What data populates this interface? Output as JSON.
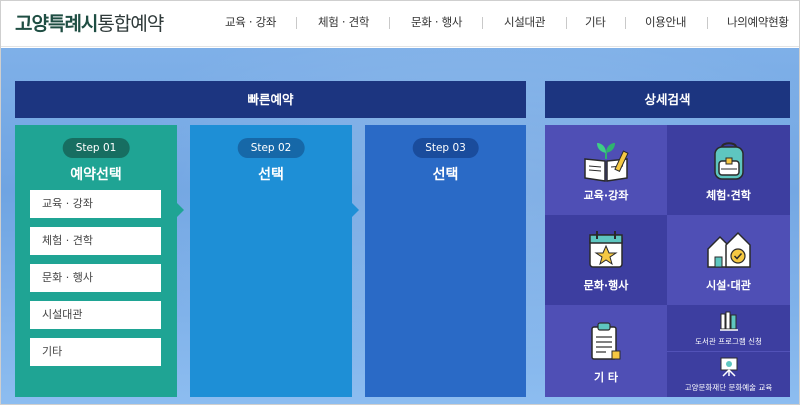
{
  "logo": {
    "bold": "고양특례시",
    "regular": "통합예약"
  },
  "nav": [
    {
      "label": "교육 · 강좌"
    },
    {
      "label": "체험 · 견학"
    },
    {
      "label": "문화 · 행사"
    },
    {
      "label": "시설대관"
    },
    {
      "label": "기타"
    },
    {
      "label": "이용안내"
    },
    {
      "label": "나의예약현황"
    }
  ],
  "quick": {
    "title": "빠른예약",
    "steps": [
      {
        "badge": "Step 01",
        "title": "예약선택"
      },
      {
        "badge": "Step 02",
        "title": "선택"
      },
      {
        "badge": "Step 03",
        "title": "선택"
      }
    ],
    "categories": [
      {
        "label": "교육 · 강좌"
      },
      {
        "label": "체험 · 견학"
      },
      {
        "label": "문화 · 행사"
      },
      {
        "label": "시설대관"
      },
      {
        "label": "기타"
      }
    ]
  },
  "detail": {
    "title": "상세검색",
    "cells": [
      {
        "label": "교육·강좌",
        "icon": "book-sprout-icon"
      },
      {
        "label": "체험·견학",
        "icon": "backpack-icon"
      },
      {
        "label": "문화·행사",
        "icon": "calendar-star-icon"
      },
      {
        "label": "시설·대관",
        "icon": "buildings-check-icon"
      },
      {
        "label": "기 타",
        "icon": "clipboard-icon"
      },
      {
        "label": "도서관 프로그램 신청",
        "icon": "library-books-icon"
      },
      {
        "label": "고양문화재단 문화예술 교육",
        "icon": "easel-icon"
      }
    ]
  },
  "colors": {
    "navy": "#1c3580",
    "step1": "#1fa494",
    "step2": "#1e8fd6",
    "step3": "#2a6ac6",
    "grid_light": "#4f4fb5",
    "grid_dark": "#3d3ea0"
  }
}
